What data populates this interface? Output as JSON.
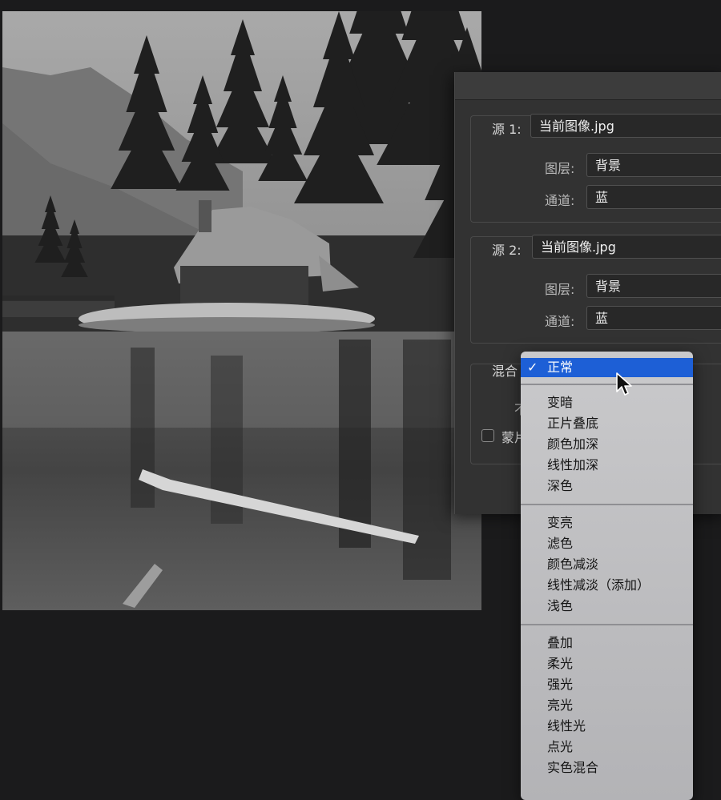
{
  "dialog": {
    "source1": {
      "label": "源 1:",
      "value": "当前图像.jpg"
    },
    "layer1": {
      "label": "图层:",
      "value": "背景"
    },
    "channel1": {
      "label": "通道:",
      "value": "蓝"
    },
    "source2": {
      "label": "源 2:",
      "value": "当前图像.jpg"
    },
    "layer2": {
      "label": "图层:",
      "value": "背景"
    },
    "channel2": {
      "label": "通道:",
      "value": "蓝"
    },
    "blend_label": "混合",
    "opacity_label_fragment": "不",
    "mask_label_fragment": "蒙片"
  },
  "menu": {
    "selected": "正常",
    "group1": [
      "变暗",
      "正片叠底",
      "颜色加深",
      "线性加深",
      "深色"
    ],
    "group2": [
      "变亮",
      "滤色",
      "颜色减淡",
      "线性减淡（添加）",
      "浅色"
    ],
    "group3": [
      "叠加",
      "柔光",
      "强光",
      "亮光",
      "线性光",
      "点光",
      "实色混合"
    ]
  },
  "icons": {
    "check": "checkmark-icon",
    "cursor": "mouse-pointer-icon"
  },
  "colors": {
    "selection": "#1d5fd6",
    "menu_bg": "#c2c2c4",
    "dialog_bg": "#323232"
  }
}
